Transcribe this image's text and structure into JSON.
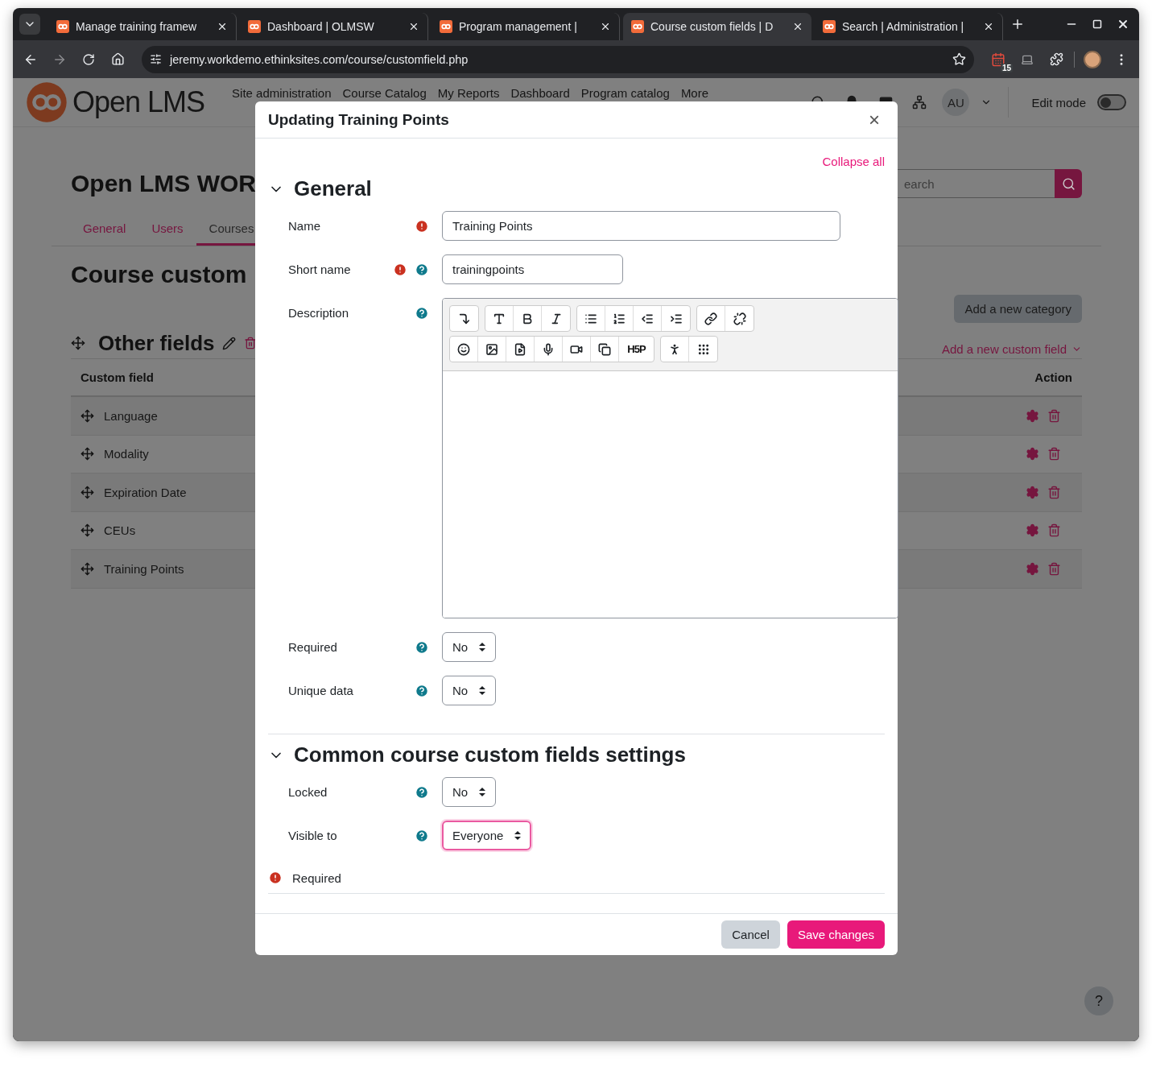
{
  "browser": {
    "tabs": [
      {
        "title": "Manage training framew",
        "selected": false
      },
      {
        "title": "Dashboard | OLMSW",
        "selected": false
      },
      {
        "title": "Program management |",
        "selected": false
      },
      {
        "title": "Course custom fields | D",
        "selected": true
      },
      {
        "title": "Search | Administration |",
        "selected": false
      }
    ],
    "url": "jeremy.workdemo.ethinksites.com/course/customfield.php",
    "extension_badge": "15"
  },
  "header": {
    "logo_text": "Open LMS",
    "nav": [
      "Site administration",
      "Course Catalog",
      "My Reports",
      "Dashboard",
      "Program catalog",
      "More"
    ],
    "avatar": "AU",
    "edit_mode": {
      "label": "Edit mode",
      "on": false
    }
  },
  "page": {
    "title": "Open LMS WOR",
    "search_placeholder": "earch",
    "tabs": [
      {
        "label": "General",
        "selected": false
      },
      {
        "label": "Users",
        "selected": false
      },
      {
        "label": "Courses",
        "selected": true
      }
    ],
    "heading": "Course custom",
    "add_category": "Add a new category",
    "category": "Other fields",
    "add_field": "Add a new custom field",
    "columns": [
      "Custom field",
      "Action"
    ],
    "rows": [
      {
        "name": "Language"
      },
      {
        "name": "Modality"
      },
      {
        "name": "Expiration Date"
      },
      {
        "name": "CEUs"
      },
      {
        "name": "Training Points"
      }
    ]
  },
  "dialog": {
    "title": "Updating Training Points",
    "close": "×",
    "collapse_all": "Collapse all",
    "sections": [
      {
        "title": "General",
        "expanded": true,
        "fields": [
          {
            "kind": "text",
            "label": "Name",
            "required": true,
            "help": false,
            "value": "Training Points",
            "wide": true
          },
          {
            "kind": "text",
            "label": "Short name",
            "required": true,
            "help": true,
            "value": "trainingpoints",
            "wide": false
          },
          {
            "kind": "editor",
            "label": "Description",
            "required": false,
            "help": true,
            "h5p": "H5P"
          },
          {
            "kind": "select",
            "label": "Required",
            "required": false,
            "help": true,
            "value": "No",
            "focused": false
          },
          {
            "kind": "select",
            "label": "Unique data",
            "required": false,
            "help": true,
            "value": "No",
            "focused": false
          }
        ]
      },
      {
        "title": "Common course custom fields settings",
        "expanded": true,
        "fields": [
          {
            "kind": "select",
            "label": "Locked",
            "required": false,
            "help": true,
            "value": "No",
            "focused": false
          },
          {
            "kind": "select",
            "label": "Visible to",
            "required": false,
            "help": true,
            "value": "Everyone",
            "focused": true
          }
        ]
      }
    ],
    "required_note": "Required",
    "cancel": "Cancel",
    "save": "Save changes"
  },
  "help_button": "?"
}
